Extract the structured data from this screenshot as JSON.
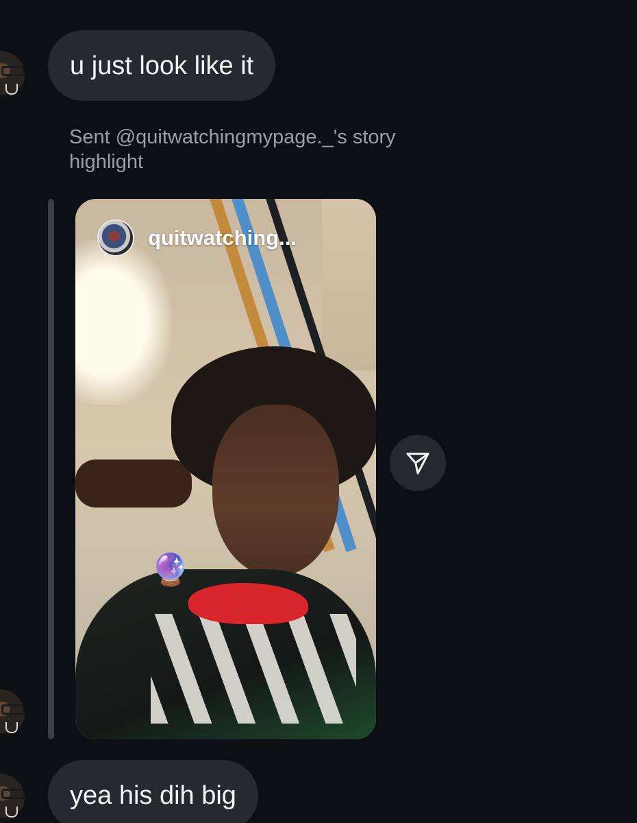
{
  "messages": [
    {
      "text": "u just look like it"
    },
    {
      "text": "yea his dih big"
    }
  ],
  "story_share": {
    "caption": "Sent @quitwatchingmypage._'s story highlight",
    "username": "quitwatching...",
    "sticker_icon": "crystal-ball"
  },
  "icons": {
    "share": "paper-plane-icon"
  }
}
